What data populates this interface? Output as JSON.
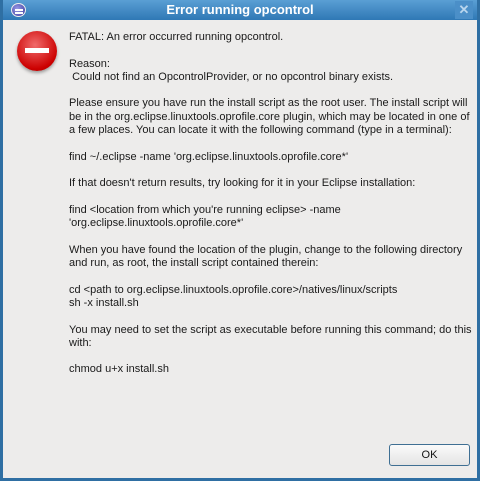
{
  "window": {
    "title": "Error running opcontrol",
    "close_glyph": "✕"
  },
  "message": {
    "lines": [
      "FATAL: An error occurred running opcontrol.",
      "",
      "Reason:",
      " Could not find an OpcontrolProvider, or no opcontrol binary exists.",
      "",
      "Please ensure you have run the install script as the root user. The install script will be in the org.eclipse.linuxtools.oprofile.core plugin, which may be located in one of a few places. You can locate it with the following command (type in a terminal):",
      "",
      "find ~/.eclipse -name 'org.eclipse.linuxtools.oprofile.core*'",
      "",
      "If that doesn't return results, try looking for it in your Eclipse installation:",
      "",
      "find <location from which you're running eclipse> -name 'org.eclipse.linuxtools.oprofile.core*'",
      "",
      "When you have found the location of the plugin, change to the following directory and run, as root, the install script contained therein:",
      "",
      "cd <path to org.eclipse.linuxtools.oprofile.core>/natives/linux/scripts",
      "sh -x install.sh",
      "",
      "You may need to set the script as executable before running this command; do this with:",
      "",
      "chmod u+x install.sh"
    ]
  },
  "buttons": {
    "ok": "OK"
  }
}
